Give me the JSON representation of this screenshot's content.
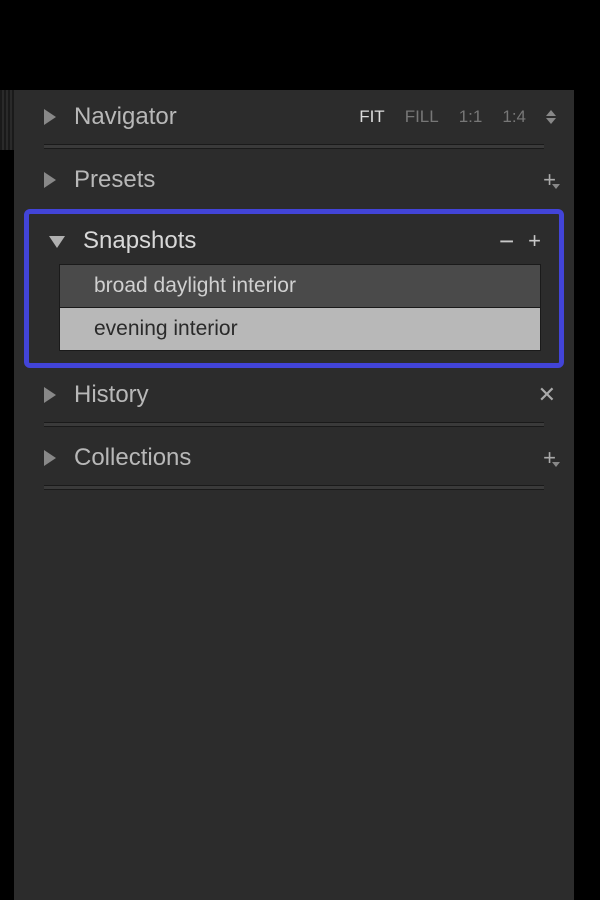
{
  "panels": {
    "navigator": {
      "title": "Navigator",
      "options": {
        "fit": "FIT",
        "fill": "FILL",
        "one_one": "1:1",
        "one_four": "1:4"
      },
      "active_option": "fit"
    },
    "presets": {
      "title": "Presets"
    },
    "snapshots": {
      "title": "Snapshots",
      "items": [
        {
          "label": "broad daylight interior",
          "selected": false
        },
        {
          "label": "evening interior",
          "selected": true
        }
      ]
    },
    "history": {
      "title": "History"
    },
    "collections": {
      "title": "Collections"
    }
  }
}
